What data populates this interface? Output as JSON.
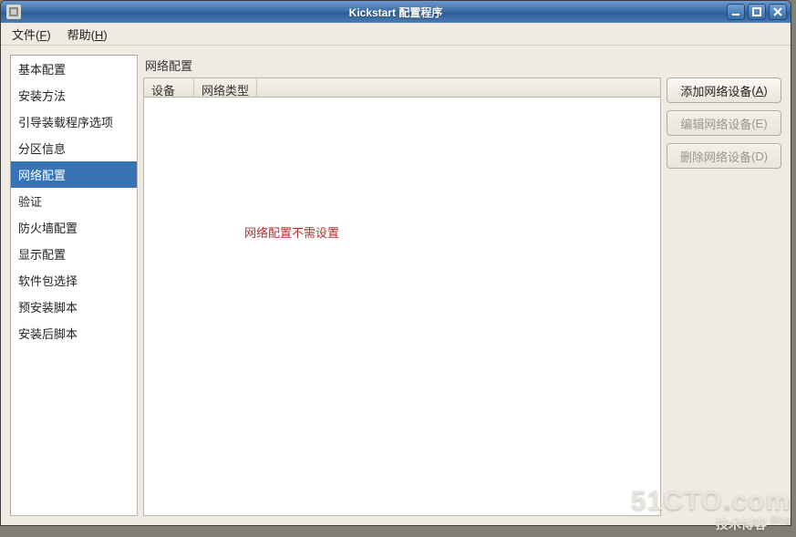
{
  "window": {
    "title": "Kickstart 配置程序"
  },
  "menus": {
    "file": {
      "label": "文件",
      "access": "F"
    },
    "help": {
      "label": "帮助",
      "access": "H"
    }
  },
  "sidebar": {
    "items": [
      {
        "label": "基本配置"
      },
      {
        "label": "安装方法"
      },
      {
        "label": "引导装载程序选项"
      },
      {
        "label": "分区信息"
      },
      {
        "label": "网络配置"
      },
      {
        "label": "验证"
      },
      {
        "label": "防火墙配置"
      },
      {
        "label": "显示配置"
      },
      {
        "label": "软件包选择"
      },
      {
        "label": "预安装脚本"
      },
      {
        "label": "安装后脚本"
      }
    ],
    "selected_index": 4
  },
  "panel": {
    "title": "网络配置",
    "columns": {
      "device": "设备",
      "type": "网络类型"
    },
    "annotation": "网络配置不需设置"
  },
  "buttons": {
    "add": {
      "label": "添加网络设备",
      "access": "A",
      "enabled": true
    },
    "edit": {
      "label": "编辑网络设备",
      "access": "E",
      "enabled": false
    },
    "delete": {
      "label": "删除网络设备",
      "access": "D",
      "enabled": false
    }
  },
  "watermark": {
    "brand_left": "51CTO",
    "brand_right": "com",
    "sub": "技术博客",
    "blog": "Blog"
  }
}
